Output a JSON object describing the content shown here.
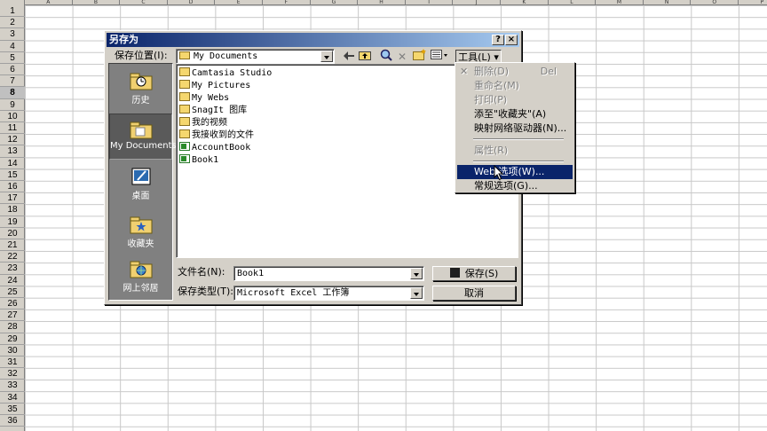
{
  "sheet": {
    "columns": [
      "A",
      "B",
      "C",
      "D",
      "E",
      "F",
      "G",
      "H",
      "I",
      "J",
      "K",
      "L",
      "M",
      "N",
      "O",
      "P"
    ],
    "rows": [
      "1",
      "2",
      "3",
      "4",
      "5",
      "6",
      "7",
      "8",
      "9",
      "10",
      "11",
      "12",
      "13",
      "14",
      "15",
      "16",
      "17",
      "18",
      "19",
      "20",
      "21",
      "22",
      "23",
      "24",
      "25",
      "26",
      "27",
      "28",
      "29",
      "30",
      "31",
      "32",
      "33",
      "34",
      "35",
      "36"
    ],
    "active_row": "8"
  },
  "dialog": {
    "title": "另存为",
    "help_button": "?",
    "close_button": "×",
    "save_in_label": "保存位置(I):",
    "save_in_value": "My Documents",
    "tools_menu_label": "工具(L)",
    "places": [
      {
        "label": "历史",
        "icon": "history-folder-icon"
      },
      {
        "label": "My Documents",
        "icon": "my-documents-folder-icon"
      },
      {
        "label": "桌面",
        "icon": "desktop-icon"
      },
      {
        "label": "收藏夹",
        "icon": "favorites-folder-icon"
      },
      {
        "label": "网上邻居",
        "icon": "network-places-icon"
      }
    ],
    "files": [
      {
        "name": "Camtasia Studio",
        "kind": "folder"
      },
      {
        "name": "My Pictures",
        "kind": "folder"
      },
      {
        "name": "My Webs",
        "kind": "folder"
      },
      {
        "name": "SnagIt 图库",
        "kind": "folder"
      },
      {
        "name": "我的视频",
        "kind": "folder"
      },
      {
        "name": "我接收到的文件",
        "kind": "folder"
      },
      {
        "name": "AccountBook",
        "kind": "excel"
      },
      {
        "name": "Book1",
        "kind": "excel"
      }
    ],
    "filename_label": "文件名(N):",
    "filename_value": "Book1",
    "filetype_label": "保存类型(T):",
    "filetype_value": "Microsoft Excel 工作簿",
    "save_button": "保存(S)",
    "cancel_button": "取消"
  },
  "tools_menu": {
    "items": [
      {
        "label": "删除(D)",
        "shortcut": "Del",
        "disabled": true
      },
      {
        "label": "重命名(M)",
        "disabled": true
      },
      {
        "label": "打印(P)",
        "disabled": true
      },
      {
        "label": "添至\"收藏夹\"(A)",
        "disabled": false
      },
      {
        "label": "映射网络驱动器(N)...",
        "disabled": false
      },
      {
        "label": "属性(R)",
        "disabled": true
      },
      {
        "label": "Web 选项(W)...",
        "disabled": false,
        "highlighted": true
      },
      {
        "label": "常规选项(G)...",
        "disabled": false
      }
    ]
  },
  "colors": {
    "title_start": "#0a246a",
    "title_end": "#a6caf0",
    "face": "#d4d0c8",
    "highlight": "#0a246a",
    "places_bg": "#808080"
  }
}
